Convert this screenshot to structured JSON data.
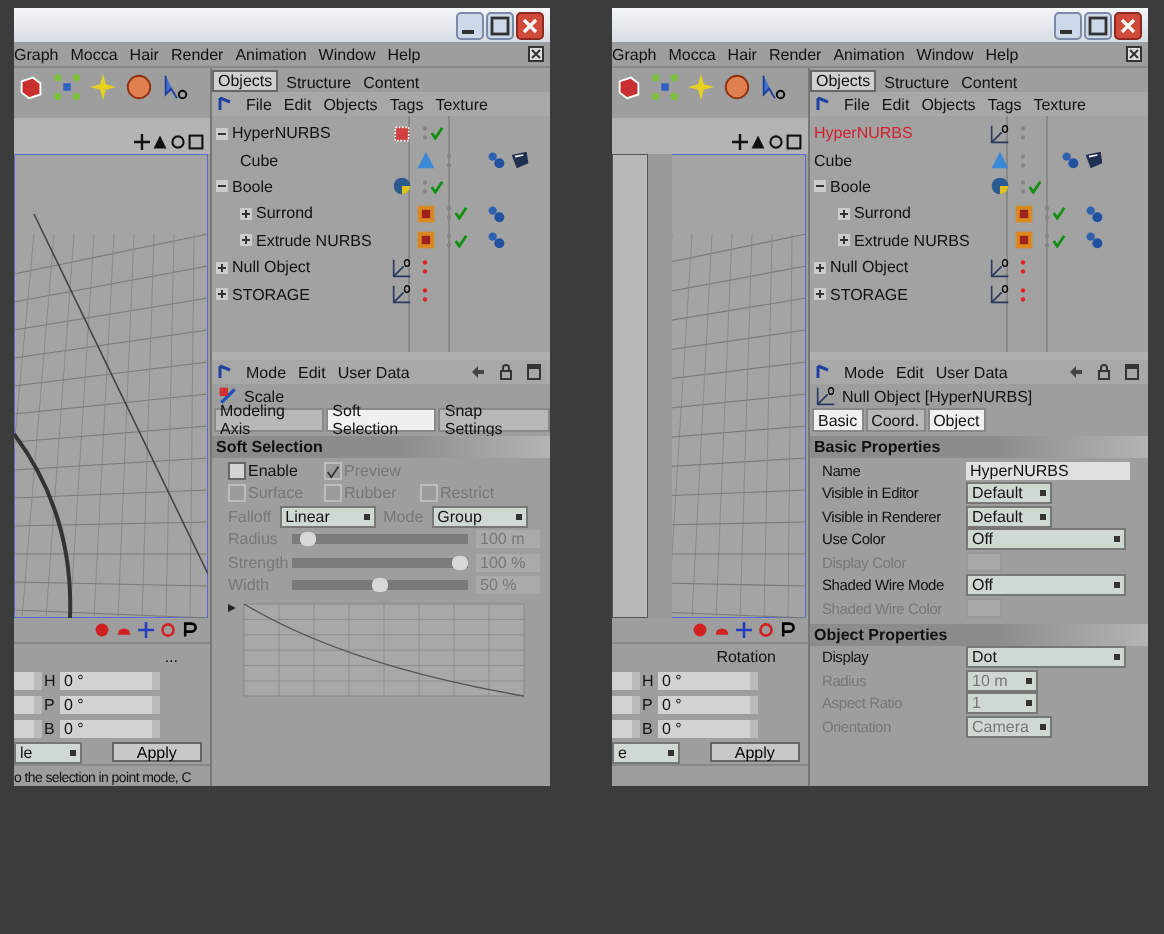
{
  "windows": [
    {
      "menu": [
        "Graph",
        "Mocca",
        "Hair",
        "Render",
        "Animation",
        "Window",
        "Help"
      ],
      "viewport": {
        "kind": "curve"
      },
      "manager_tabs": [
        {
          "label": "Objects",
          "selected": true
        },
        {
          "label": "Structure",
          "selected": false
        },
        {
          "label": "Content",
          "selected": false
        }
      ],
      "object_menu": [
        "File",
        "Edit",
        "Objects",
        "Tags",
        "Texture"
      ],
      "tree": [
        {
          "name": "HyperNURBS",
          "kind": "nurbs",
          "expanded": true,
          "selected": false,
          "enabled": true,
          "hidden": false,
          "children": [
            {
              "name": "Cube",
              "kind": "cube",
              "selected": false,
              "enabled": false,
              "hidden": false,
              "tags": [
                {
                  "kind": "phong"
                },
                {
                  "kind": "display"
                }
              ]
            }
          ]
        },
        {
          "name": "Boole",
          "kind": "boole",
          "expanded": true,
          "selected": false,
          "enabled": true,
          "hidden": false,
          "children": [
            {
              "name": "Surrond",
              "kind": "extrude",
              "expanded": false,
              "selected": false,
              "enabled": true,
              "hidden": false,
              "tags": [
                {
                  "kind": "phong"
                }
              ]
            },
            {
              "name": "Extrude NURBS",
              "kind": "extrude",
              "expanded": false,
              "selected": false,
              "enabled": true,
              "hidden": false,
              "tags": [
                {
                  "kind": "phong"
                }
              ]
            }
          ]
        },
        {
          "name": "Null Object",
          "kind": "null",
          "expanded": false,
          "selected": false,
          "enabled": false,
          "hidden": true
        },
        {
          "name": "STORAGE",
          "kind": "null",
          "expanded": false,
          "selected": false,
          "enabled": false,
          "hidden": true
        }
      ],
      "attributes": {
        "menu": [
          "Mode",
          "Edit",
          "User Data"
        ],
        "title": "Scale",
        "kind": "scale",
        "tabs": [
          {
            "label": "Modeling Axis",
            "selected": false
          },
          {
            "label": "Soft Selection",
            "selected": true
          },
          {
            "label": "Snap Settings",
            "selected": false
          }
        ],
        "sections": [
          {
            "title": "Soft Selection",
            "fields": [
              {
                "kind": "checkrow",
                "items": [
                  {
                    "label": "Enable",
                    "checked": false,
                    "disabled": false
                  },
                  {
                    "label": "Preview",
                    "checked": true,
                    "disabled": true
                  }
                ]
              },
              {
                "kind": "checkrow",
                "items": [
                  {
                    "label": "Surface",
                    "checked": false,
                    "disabled": true
                  },
                  {
                    "label": "Rubber",
                    "checked": false,
                    "disabled": true
                  },
                  {
                    "label": "Restrict",
                    "checked": false,
                    "disabled": true
                  }
                ]
              },
              {
                "kind": "dropdowns",
                "items": [
                  {
                    "label": "Falloff",
                    "value": "Linear"
                  },
                  {
                    "label": "Mode",
                    "value": "Group"
                  }
                ]
              },
              {
                "kind": "slider",
                "label": "Radius",
                "value": "100 m",
                "level": 0.05,
                "disabled": true
              },
              {
                "kind": "slider",
                "label": "Strength",
                "value": "100 %",
                "level": 1,
                "disabled": true
              },
              {
                "kind": "slider",
                "label": "Width",
                "value": "50 %",
                "level": 0.5,
                "disabled": true
              },
              {
                "kind": "curve"
              }
            ]
          }
        ]
      },
      "coordinates": {
        "heading": "...",
        "rows": [
          {
            "axis": "H",
            "value": "0 °"
          },
          {
            "axis": "P",
            "value": "0 °"
          },
          {
            "axis": "B",
            "value": "0 °"
          }
        ],
        "mode": "le",
        "apply": "Apply",
        "status": "o the selection in point mode, C"
      }
    },
    {
      "menu": [
        "Graph",
        "Mocca",
        "Hair",
        "Render",
        "Animation",
        "Window",
        "Help"
      ],
      "viewport": {
        "kind": "pillar"
      },
      "manager_tabs": [
        {
          "label": "Objects",
          "selected": true
        },
        {
          "label": "Structure",
          "selected": false
        },
        {
          "label": "Content",
          "selected": false
        }
      ],
      "object_menu": [
        "File",
        "Edit",
        "Objects",
        "Tags",
        "Texture"
      ],
      "tree": [
        {
          "name": "HyperNURBS",
          "kind": "null",
          "selected": true,
          "enabled": false,
          "hidden": false
        },
        {
          "name": "Cube",
          "kind": "cube",
          "selected": false,
          "enabled": false,
          "hidden": false,
          "tags": [
            {
              "kind": "phong"
            },
            {
              "kind": "display"
            }
          ]
        },
        {
          "name": "Boole",
          "kind": "boole",
          "expanded": true,
          "selected": false,
          "enabled": true,
          "hidden": false,
          "children": [
            {
              "name": "Surrond",
              "kind": "extrude",
              "expanded": false,
              "selected": false,
              "enabled": true,
              "hidden": false,
              "tags": [
                {
                  "kind": "phong"
                }
              ]
            },
            {
              "name": "Extrude NURBS",
              "kind": "extrude",
              "expanded": false,
              "selected": false,
              "enabled": true,
              "hidden": false,
              "tags": [
                {
                  "kind": "phong"
                }
              ]
            }
          ]
        },
        {
          "name": "Null Object",
          "kind": "null",
          "expanded": false,
          "selected": false,
          "enabled": false,
          "hidden": true
        },
        {
          "name": "STORAGE",
          "kind": "null",
          "expanded": false,
          "selected": false,
          "enabled": false,
          "hidden": true
        }
      ],
      "attributes": {
        "menu": [
          "Mode",
          "Edit",
          "User Data"
        ],
        "title": "Null Object [HyperNURBS]",
        "kind": "null",
        "tabs": [
          {
            "label": "Basic",
            "selected": true
          },
          {
            "label": "Coord.",
            "selected": false
          },
          {
            "label": "Object",
            "selected": true
          }
        ],
        "sections": [
          {
            "title": "Basic Properties",
            "fields": [
              {
                "kind": "text",
                "label": "Name",
                "value": "HyperNURBS",
                "disabled": false
              },
              {
                "kind": "dropdown",
                "label": "Visible in Editor",
                "value": "Default",
                "disabled": false
              },
              {
                "kind": "dropdown",
                "label": "Visible in Renderer",
                "value": "Default",
                "disabled": false
              },
              {
                "kind": "wide-dropdown",
                "label": "Use Color",
                "value": "Off",
                "disabled": false
              },
              {
                "kind": "color",
                "label": "Display Color",
                "disabled": true
              },
              {
                "kind": "wide-dropdown",
                "label": "Shaded Wire Mode",
                "value": "Off",
                "disabled": false
              },
              {
                "kind": "color",
                "label": "Shaded Wire Color",
                "disabled": true
              }
            ]
          },
          {
            "title": "Object Properties",
            "fields": [
              {
                "kind": "wide-dropdown",
                "label": "Display",
                "value": "Dot",
                "disabled": false
              },
              {
                "kind": "number",
                "label": "Radius",
                "value": "10 m",
                "disabled": true
              },
              {
                "kind": "number",
                "label": "Aspect Ratio",
                "value": "1",
                "disabled": true
              },
              {
                "kind": "dropdown",
                "label": "Orientation",
                "value": "Camera",
                "disabled": true
              }
            ]
          }
        ]
      },
      "coordinates": {
        "heading": "Rotation",
        "rows": [
          {
            "axis": "H",
            "value": "0 °"
          },
          {
            "axis": "P",
            "value": "0 °"
          },
          {
            "axis": "B",
            "value": "0 °"
          }
        ],
        "mode": "e",
        "apply": "Apply"
      }
    }
  ]
}
